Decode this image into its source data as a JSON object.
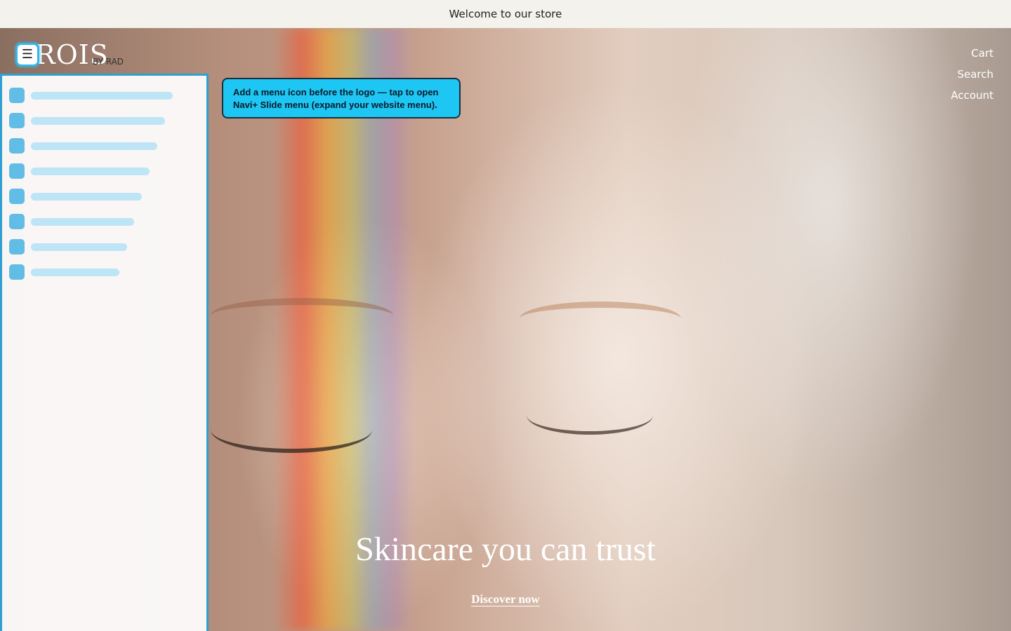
{
  "announcement": {
    "text": "Welcome to our store"
  },
  "header": {
    "menu_icon_glyph": "☰",
    "logo_text": "ROIS",
    "logo_sub": "BY RAD",
    "nav": [
      {
        "label": "Cart"
      },
      {
        "label": "Search"
      },
      {
        "label": "Account"
      }
    ]
  },
  "tooltip": {
    "text": "Add a menu icon before the logo — tap to open Navi+ Slide menu (expand your website menu)."
  },
  "hero": {
    "title": "Skincare you can trust",
    "cta_label": "Discover now"
  },
  "colors": {
    "accent": "#36b6e6",
    "tooltip_bg": "#1ec6f4",
    "skeleton_square": "#62bde6",
    "skeleton_bar": "#bde5f6"
  },
  "skeleton_menu": {
    "item_count": 8
  }
}
